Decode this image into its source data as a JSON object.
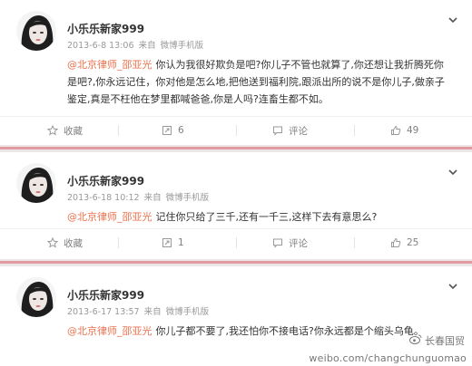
{
  "colors": {
    "mention": "#eb7350",
    "accent_band": "#e29aa3",
    "page_bg": "#ede6e6",
    "muted": "#999999"
  },
  "posts": [
    {
      "user": "小乐乐新家999",
      "time": "2013-6-8 13:06",
      "source_prefix": "来自",
      "source": "微博手机版",
      "mention": "@北京律师_邵亚光",
      "body": "你认为我很好欺负是吧?你儿子不管也就算了,你还想让我折腾死你是吧?,你永远记住，你对他是怎么地,把他送到福利院,跟派出所的说不是你儿子,做亲子鉴定,真是不枉他在梦里都喊爸爸,你是人吗?连畜生都不如。",
      "actions": {
        "favorite": "收藏",
        "repost": "6",
        "comment": "评论",
        "like": "49"
      }
    },
    {
      "user": "小乐乐新家999",
      "time": "2013-6-18 10:12",
      "source_prefix": "来自",
      "source": "微博手机版",
      "mention": "@北京律师_邵亚光",
      "body": "记住你只给了三千,还有一千三,这样下去有意思么?",
      "actions": {
        "favorite": "收藏",
        "repost": "1",
        "comment": "评论",
        "like": "25"
      }
    },
    {
      "user": "小乐乐新家999",
      "time": "2013-6-17 13:57",
      "source_prefix": "来自",
      "source": "微博手机版",
      "mention": "@北京律师_邵亚光",
      "body": "你儿子都不要了,我还怕你不接电话?你永远都是个缩头乌龟。"
    }
  ],
  "watermark": {
    "brand": "长春国贸",
    "url": "weibo.com/changchunguomao"
  },
  "icons": {
    "chevron": "chevron-down-icon",
    "favorite": "star-icon",
    "repost": "repost-icon",
    "comment": "comment-icon",
    "like": "thumbs-up-icon"
  }
}
